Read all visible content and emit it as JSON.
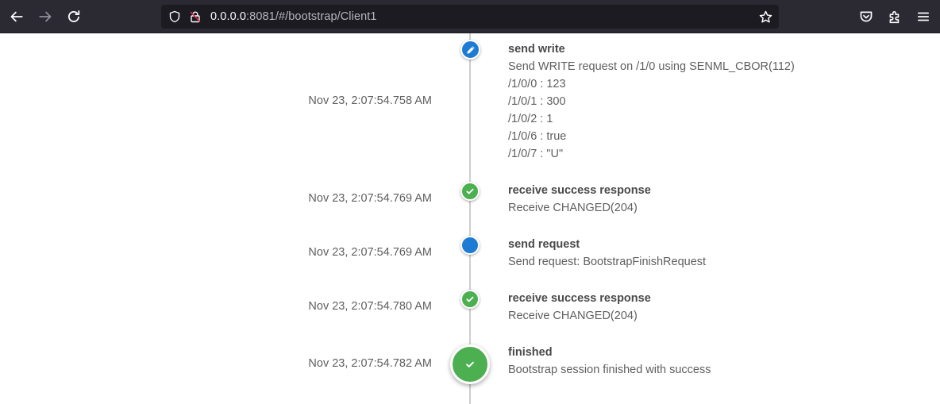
{
  "browser": {
    "url_host": "0.0.0.0",
    "url_rest": ":8081/#/bootstrap/Client1",
    "icons": {
      "back": "back-arrow-icon",
      "forward": "forward-arrow-icon",
      "reload": "reload-icon",
      "shield": "shield-icon",
      "lock": "insecure-lock-icon",
      "bookmark": "star-bookmark-icon",
      "pocket": "pocket-icon",
      "extensions": "extensions-icon",
      "menu": "hamburger-menu-icon"
    }
  },
  "timeline": {
    "colors": {
      "info": "#1e7bd4",
      "success": "#4caf50",
      "line": "#cfcfcf"
    },
    "events": [
      {
        "time": "Nov 23, 2:07:54.758 AM",
        "title": "send write",
        "icon": "pencil-icon",
        "status": "info",
        "lines": [
          "Send WRITE request on /1/0 using SENML_CBOR(112)",
          "/1/0/0 : 123",
          "/1/0/1 : 300",
          "/1/0/2 : 1",
          "/1/0/6 : true",
          "/1/0/7 : \"U\""
        ]
      },
      {
        "time": "Nov 23, 2:07:54.769 AM",
        "title": "receive success response",
        "icon": "check-icon",
        "status": "success",
        "lines": [
          "Receive CHANGED(204)"
        ]
      },
      {
        "time": "Nov 23, 2:07:54.769 AM",
        "title": "send request",
        "icon": "dot-icon",
        "status": "info",
        "lines": [
          "Send request: BootstrapFinishRequest"
        ]
      },
      {
        "time": "Nov 23, 2:07:54.780 AM",
        "title": "receive success response",
        "icon": "check-icon",
        "status": "success",
        "lines": [
          "Receive CHANGED(204)"
        ]
      },
      {
        "time": "Nov 23, 2:07:54.782 AM",
        "title": "finished",
        "icon": "check-icon",
        "status": "success",
        "lines": [
          "Bootstrap session finished with success"
        ]
      }
    ]
  }
}
